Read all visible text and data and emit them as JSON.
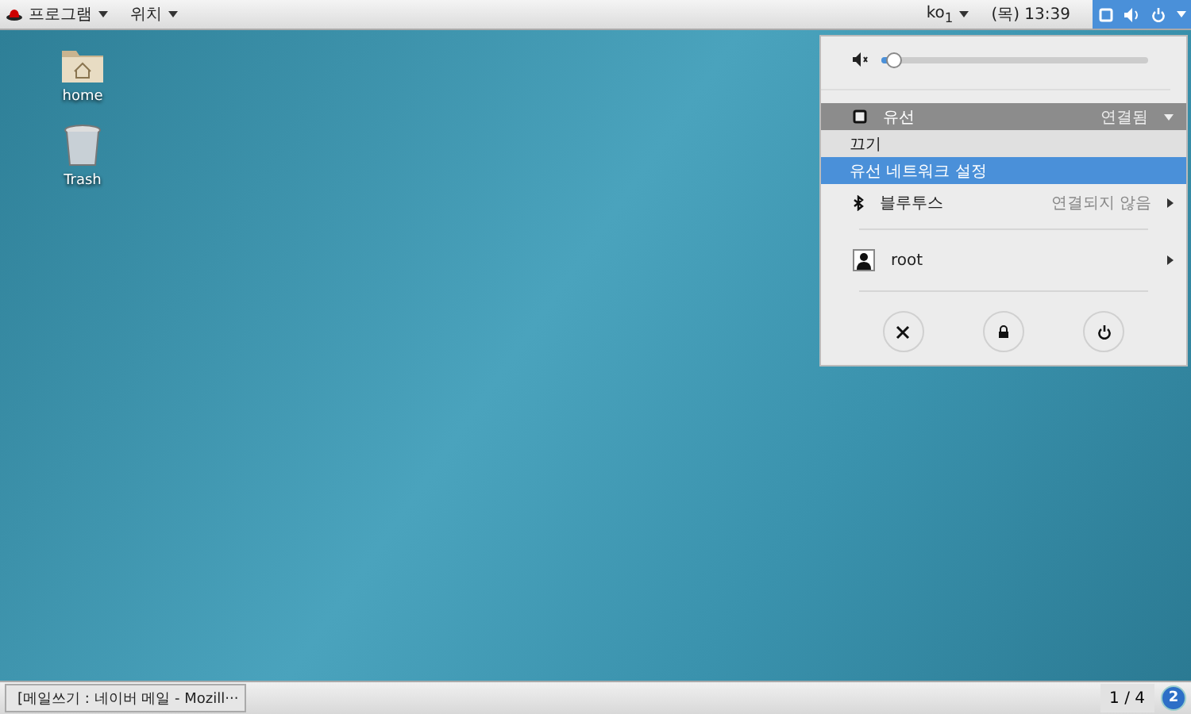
{
  "top_bar": {
    "applications": "프로그램",
    "places": "위치",
    "keyboard": "ko$_{1}$",
    "clock": "(목) 13:39"
  },
  "desktop_icons": [
    {
      "kind": "folder",
      "label": "home"
    },
    {
      "kind": "trash",
      "label": "Trash"
    }
  ],
  "system_menu": {
    "volume": {
      "level": 0.05
    },
    "wired": {
      "label": "유선",
      "status": "연결됨",
      "expanded": true,
      "items": [
        {
          "label": "끄기",
          "selected": false
        },
        {
          "label": "유선 네트워크 설정",
          "selected": true
        }
      ]
    },
    "bluetooth": {
      "label": "블루투스",
      "status": "연결되지 않음"
    },
    "user": {
      "name": "root"
    }
  },
  "taskbar": {
    "window": "[메일쓰기 : 네이버 메일 - Mozill···",
    "workspace": "1 / 4",
    "notifications": "2"
  }
}
